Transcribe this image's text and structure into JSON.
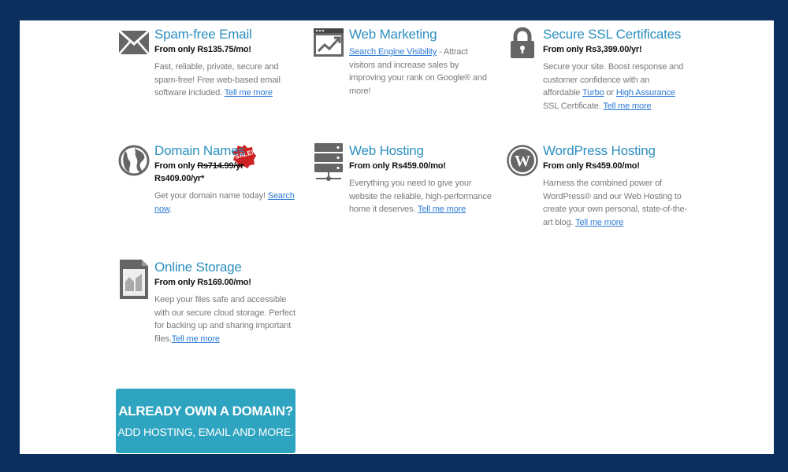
{
  "products": [
    {
      "title": "Spam-free Email",
      "price_prefix": "From only ",
      "price": "Rs135.75/mo!",
      "desc": "Fast, reliable, private, secure and spam-free! Free web-based email software included.",
      "link": "Tell me more",
      "icon": "envelope-icon"
    },
    {
      "title": "Web Marketing",
      "link_first": "Search Engine Visibility",
      "desc": " - Attract visitors and increase sales by improving your rank on Google® and more!",
      "icon": "chart-up-icon"
    },
    {
      "title": "Secure SSL Certificates",
      "price_prefix": "From only ",
      "price": "Rs3,399.00/yr!",
      "desc": "Secure your site. Boost response and customer confidence with an affordable",
      "link_turbo": "Turbo",
      "or_text": " or ",
      "link_high": "High Assurance",
      "desc_end": " SSL Certificate.",
      "link": "Tell me more",
      "icon": "padlock-icon"
    },
    {
      "title": "Domain Names",
      "price_prefix": "From only ",
      "old_price": "Rs714.99/yr",
      "new_price": "Rs409.00/yr*",
      "desc": "Get your domain name today! ",
      "link": "Search now",
      "desc_end": ".",
      "badge": "SALE!",
      "icon": "globe-icon"
    },
    {
      "title": "Web Hosting",
      "price_prefix": "From only ",
      "price": "Rs459.00/mo!",
      "desc": "Everything you need to give your website the reliable, high-performance home it deserves. ",
      "link": "Tell me more",
      "icon": "server-icon"
    },
    {
      "title": "WordPress Hosting",
      "price_prefix": "From only ",
      "price": "Rs459.00/mo!",
      "desc": "Harness the combined power of WordPress® and our Web Hosting to create your own personal, state-of-the-art blog. ",
      "link": "Tell me more",
      "icon": "wordpress-icon"
    },
    {
      "title": "Online Storage",
      "price_prefix": "From only ",
      "price": "Rs169.00/mo!",
      "desc": "Keep your files safe and accessible with our secure cloud storage. Perfect for backing up and sharing important files.",
      "link": "Tell me more",
      "icon": "file-storage-icon"
    }
  ],
  "cta": {
    "line1": "ALREADY OWN A DOMAIN?",
    "line2": "ADD HOSTING, EMAIL AND MORE."
  },
  "colors": {
    "background": "#0b2f5e",
    "title": "#2c8fbf",
    "link": "#2b7bd6",
    "cta": "#2fa4c1",
    "badge": "#cc2222"
  }
}
